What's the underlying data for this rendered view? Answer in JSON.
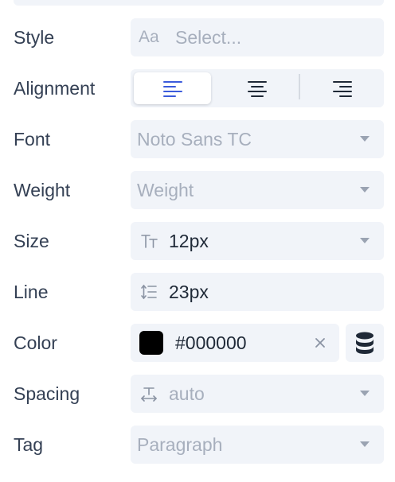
{
  "panel": {
    "rows": {
      "style": {
        "label": "Style",
        "icon_text": "Aa",
        "placeholder": "Select..."
      },
      "alignment": {
        "label": "Alignment",
        "options": [
          "left",
          "center",
          "right"
        ],
        "selected": "left"
      },
      "font": {
        "label": "Font",
        "value": "Noto Sans TC"
      },
      "weight": {
        "label": "Weight",
        "value": "Weight"
      },
      "size": {
        "label": "Size",
        "value": "12px"
      },
      "line": {
        "label": "Line",
        "value": "23px"
      },
      "color": {
        "label": "Color",
        "value": "#000000",
        "swatch": "#000000"
      },
      "spacing": {
        "label": "Spacing",
        "value": "auto"
      },
      "tag": {
        "label": "Tag",
        "value": "Paragraph"
      }
    }
  },
  "colors": {
    "field_bg": "#f1f4f9",
    "accent": "#3b5bdb",
    "placeholder": "#a7afbd",
    "text": "#1f2937"
  },
  "icons": {
    "style": "font-icon",
    "align_left": "align-left-icon",
    "align_center": "align-center-icon",
    "align_right": "align-right-icon",
    "size": "text-size-icon",
    "line": "line-height-icon",
    "spacing": "letter-spacing-icon",
    "variables": "database-icon",
    "clear": "close-icon",
    "dropdown": "chevron-down-icon"
  }
}
